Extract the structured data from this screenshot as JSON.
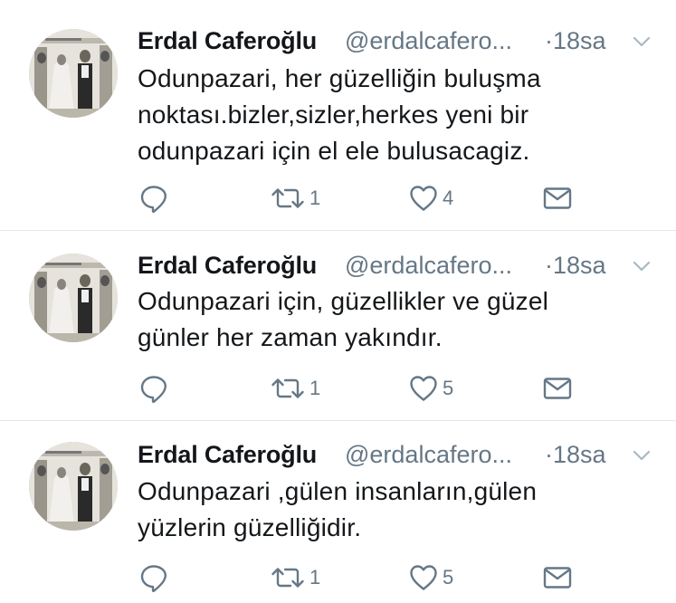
{
  "tweets": [
    {
      "author": {
        "name": "Erdal Caferoğlu",
        "handle": "@erdalcafero...",
        "avatar": "vintage-photo-avatar"
      },
      "time": "·18sa",
      "text": "Odunpazari, her güzelliğin buluşma\nnoktası.bizler,sizler,herkes yeni bir\nodunpazari için el ele bulusacagiz.",
      "actions": {
        "retweets": "1",
        "likes": "4"
      }
    },
    {
      "author": {
        "name": "Erdal Caferoğlu",
        "handle": "@erdalcafero...",
        "avatar": "vintage-photo-avatar"
      },
      "time": "·18sa",
      "text": "Odunpazari için, güzellikler ve güzel\ngünler her zaman yakındır.",
      "actions": {
        "retweets": "1",
        "likes": "5"
      }
    },
    {
      "author": {
        "name": "Erdal Caferoğlu",
        "handle": "@erdalcafero...",
        "avatar": "vintage-photo-avatar"
      },
      "time": "·18sa",
      "text": "Odunpazari ,gülen insanların,gülen\nyüzlerin güzelliğidir.",
      "actions": {
        "retweets": "1",
        "likes": "5"
      }
    }
  ],
  "icons": {
    "reply": "reply-icon",
    "retweet": "retweet-icon",
    "like": "heart-icon",
    "dm": "envelope-icon",
    "menu": "chevron-down-icon"
  },
  "colors": {
    "text": "#14171a",
    "muted": "#657786",
    "icon": "#657786",
    "divider": "#e1e8ed"
  }
}
